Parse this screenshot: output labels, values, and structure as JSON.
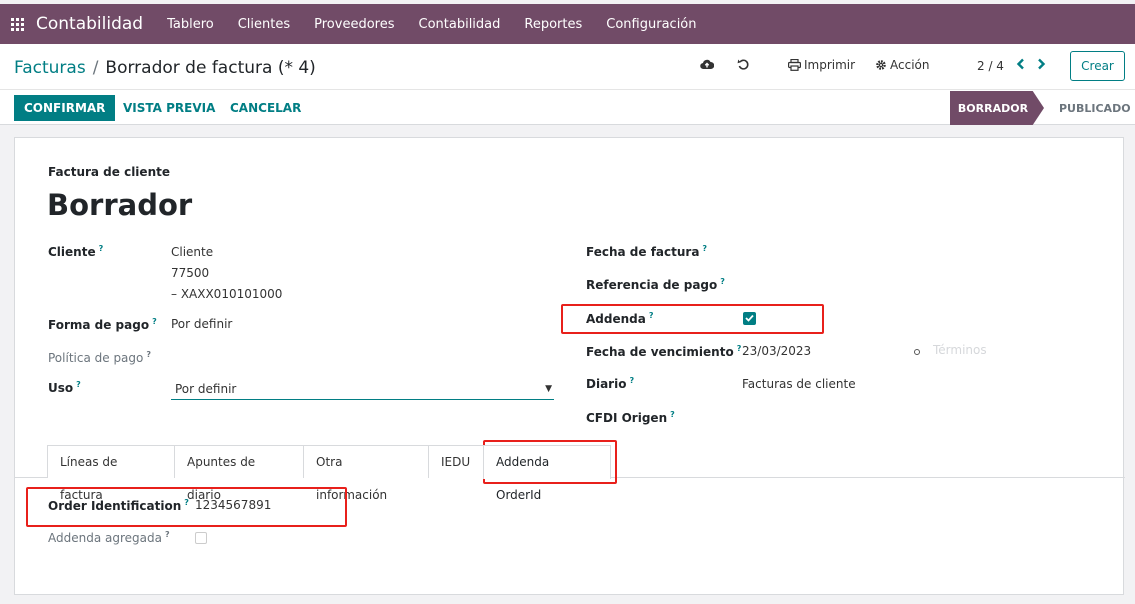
{
  "navbar": {
    "brand": "Contabilidad",
    "items": [
      "Tablero",
      "Clientes",
      "Proveedores",
      "Contabilidad",
      "Reportes",
      "Configuración"
    ]
  },
  "breadcrumb": {
    "parent": "Facturas",
    "separator": "/",
    "current": "Borrador de factura (* 4)"
  },
  "toolbar": {
    "print_label": "Imprimir",
    "action_label": "Acción",
    "pager": "2 / 4",
    "create_label": "Crear"
  },
  "status_bar": {
    "confirm_label": "CONFIRMAR",
    "preview_label": "VISTA PREVIA",
    "cancel_label": "CANCELAR",
    "stage_draft": "BORRADOR",
    "stage_posted": "PUBLICADO"
  },
  "form": {
    "doc_type": "Factura de cliente",
    "title": "Borrador",
    "left": {
      "cliente_label": "Cliente",
      "cliente_lines": [
        "Cliente",
        "77500",
        "– XAXX010101000"
      ],
      "forma_pago_label": "Forma de pago",
      "forma_pago_value": "Por definir",
      "politica_label": "Política de pago",
      "uso_label": "Uso",
      "uso_value": "Por definir"
    },
    "right": {
      "fecha_factura_label": "Fecha de factura",
      "referencia_label": "Referencia de pago",
      "addenda_label": "Addenda",
      "addenda_checked": true,
      "vencimiento_label": "Fecha de vencimiento",
      "vencimiento_value": "23/03/2023",
      "terminos_placeholder": "Términos",
      "diario_label": "Diario",
      "diario_value": "Facturas de cliente",
      "cfdi_label": "CFDI Origen"
    },
    "hint_mark": "?"
  },
  "tabs": [
    "Líneas de factura",
    "Apuntes de diario",
    "Otra información",
    "IEDU",
    "Addenda OrderId"
  ],
  "active_tab": "Addenda OrderId",
  "addenda_tab": {
    "order_label": "Order Identification",
    "order_value": "1234567891",
    "agregada_label": "Addenda agregada",
    "agregada_checked": false
  },
  "colors": {
    "brand": "#714b67",
    "accent": "#017e84",
    "highlight": "#e8201b"
  }
}
